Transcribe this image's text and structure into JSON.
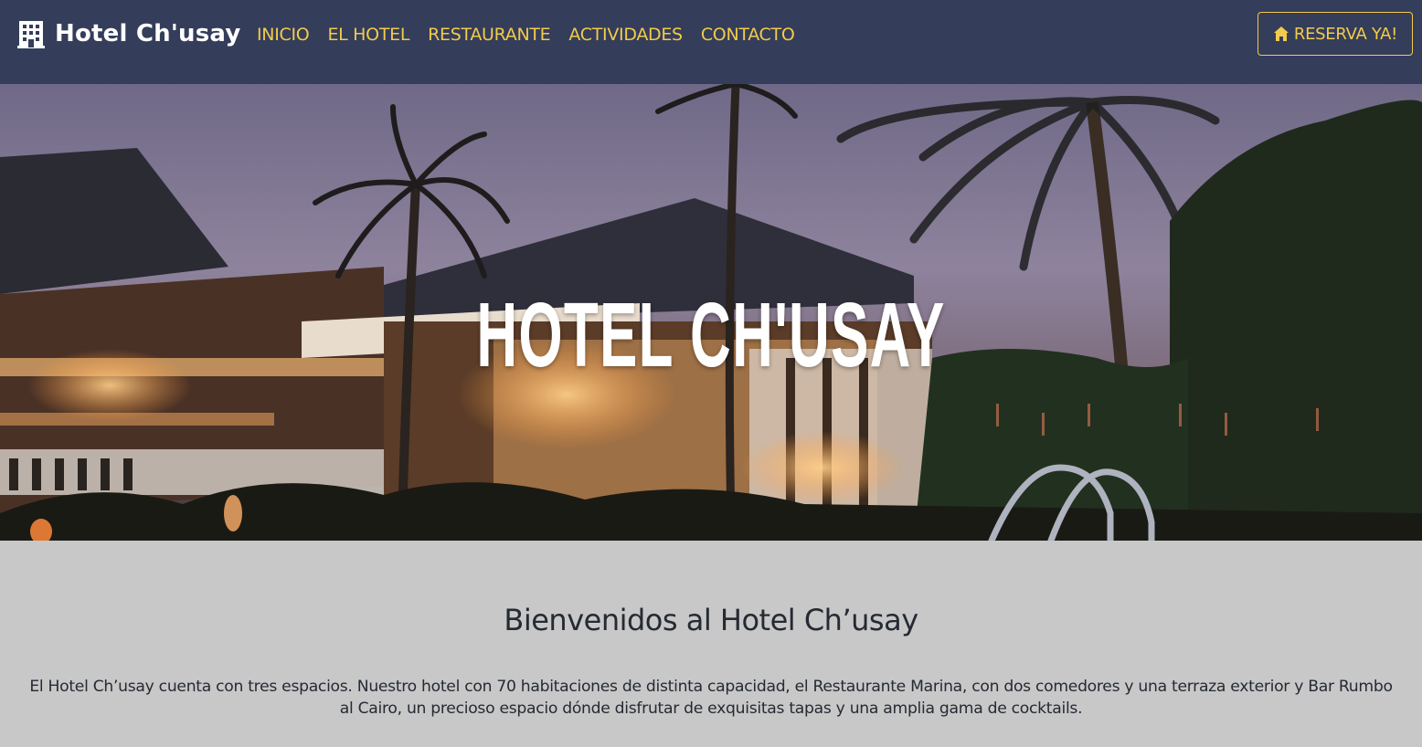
{
  "navbar": {
    "brand": "Hotel Ch'usay",
    "links": [
      "INICIO",
      "EL HOTEL",
      "RESTAURANTE",
      "ACTIVIDADES",
      "CONTACTO"
    ],
    "reserve_label": "RESERVA YA!"
  },
  "hero": {
    "title": "HOTEL CH'USAY"
  },
  "welcome": {
    "heading": "Bienvenidos al Hotel Ch’usay",
    "text": "El Hotel Ch’usay cuenta con tres espacios. Nuestro hotel con 70 habitaciones de distinta capacidad, el Restaurante Marina, con dos comedores y una terraza exterior y Bar Rumbo al Cairo, un precioso espacio dónde disfrutar de exquisitas tapas y una amplia gama de cocktails."
  },
  "colors": {
    "navbar_bg": "#343d5a",
    "accent": "#f2cb4a",
    "page_bg": "#c8c8c8",
    "text": "#252a33"
  },
  "icons": {
    "brand": "building-icon",
    "reserve": "house-icon"
  }
}
